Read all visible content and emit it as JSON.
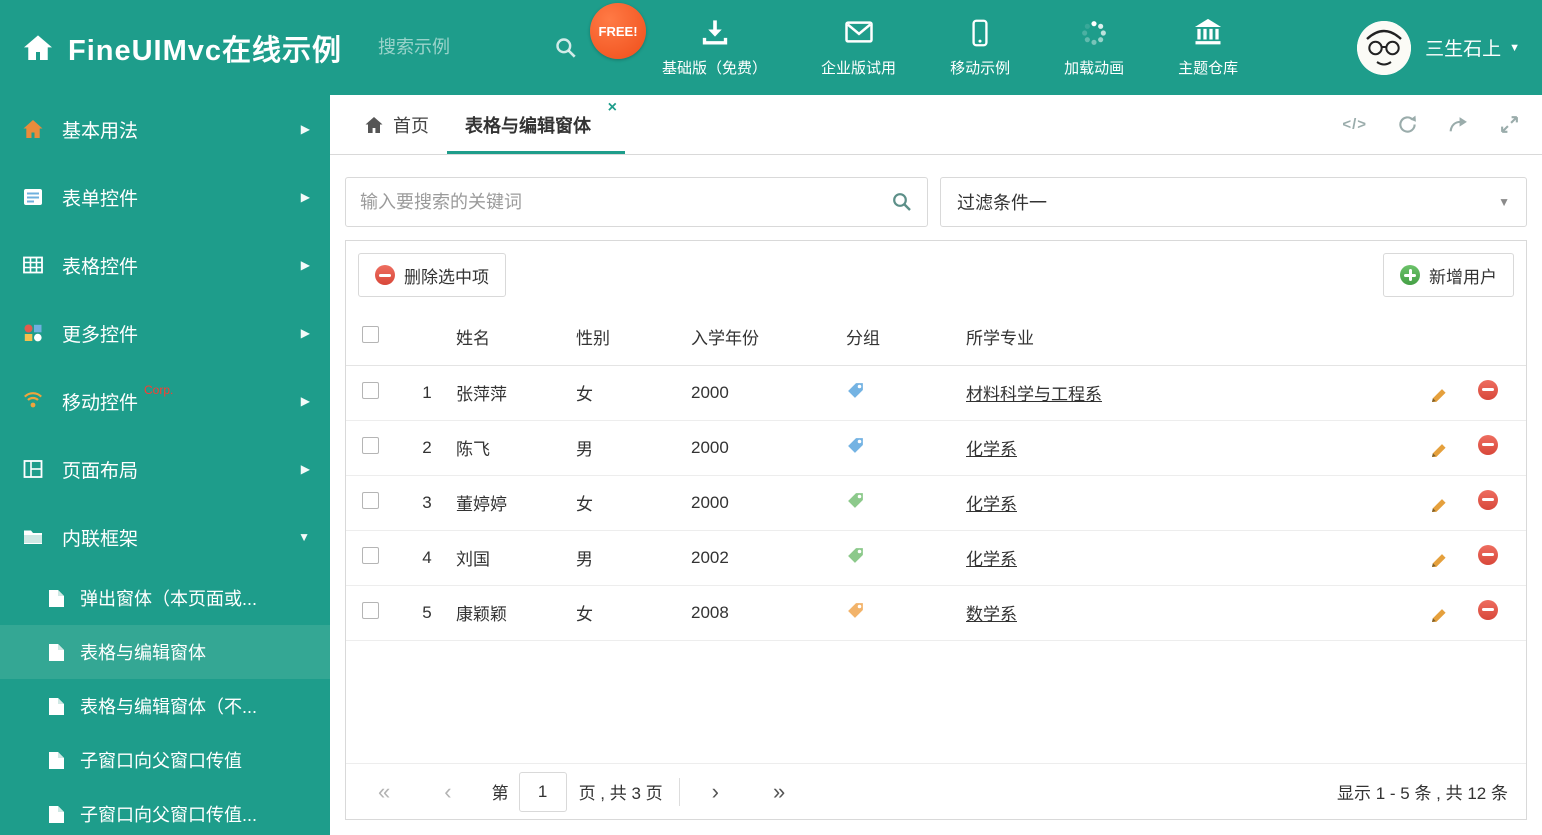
{
  "theme": {
    "accent": "#1e9d8b",
    "sidebar_selected": "#34a794",
    "free_badge_bg": "#ef4e1a",
    "delete_red": "#d8473a",
    "add_green": "#45a045",
    "edit_orange": "#e5a03c",
    "link_color": "#333333"
  },
  "icons": {
    "chevron_right": "▶",
    "chevron_down": "▼",
    "caret_down": "▼",
    "close": "×",
    "code": "</>",
    "page_first": "«",
    "page_prev": "‹",
    "page_next": "›",
    "page_last": "»"
  },
  "header": {
    "title": "FineUIMvc在线示例",
    "search_placeholder": "搜索示例",
    "free_badge": "FREE!",
    "nav_items": [
      {
        "label": "基础版（免费）",
        "icon": "download-icon"
      },
      {
        "label": "企业版试用",
        "icon": "envelope-icon"
      },
      {
        "label": "移动示例",
        "icon": "mobile-icon"
      },
      {
        "label": "加载动画",
        "icon": "spinner-icon"
      },
      {
        "label": "主题仓库",
        "icon": "bank-icon"
      }
    ],
    "user": {
      "name": "三生石上"
    }
  },
  "sidebar": {
    "items": [
      {
        "label": "基本用法",
        "icon": "home-icon"
      },
      {
        "label": "表单控件",
        "icon": "form-icon"
      },
      {
        "label": "表格控件",
        "icon": "table-icon"
      },
      {
        "label": "更多控件",
        "icon": "widgets-icon"
      },
      {
        "label": "移动控件",
        "badge": "Corp.",
        "icon": "signal-icon"
      },
      {
        "label": "页面布局",
        "icon": "layout-icon"
      },
      {
        "label": "内联框架",
        "icon": "frame-icon",
        "expanded": true
      }
    ],
    "subitems": [
      {
        "label": "弹出窗体（本页面或..."
      },
      {
        "label": "表格与编辑窗体",
        "selected": true
      },
      {
        "label": "表格与编辑窗体（不..."
      },
      {
        "label": "子窗口向父窗口传值"
      },
      {
        "label": "子窗口向父窗口传值..."
      }
    ]
  },
  "tabs": [
    {
      "label": "首页",
      "icon": "home-icon"
    },
    {
      "label": "表格与编辑窗体",
      "active": true,
      "closable": true
    }
  ],
  "filter": {
    "search_placeholder": "输入要搜索的关键词",
    "dropdown_value": "过滤条件一"
  },
  "toolbar": {
    "delete_label": "删除选中项",
    "add_label": "新增用户"
  },
  "table": {
    "columns": [
      "姓名",
      "性别",
      "入学年份",
      "分组",
      "所学专业"
    ],
    "rows": [
      {
        "num": "1",
        "name": "张萍萍",
        "gender": "女",
        "year": "2000",
        "tag_color": "#74b3e3",
        "major": "材料科学与工程系"
      },
      {
        "num": "2",
        "name": "陈飞",
        "gender": "男",
        "year": "2000",
        "tag_color": "#74b3e3",
        "major": "化学系"
      },
      {
        "num": "3",
        "name": "董婷婷",
        "gender": "女",
        "year": "2000",
        "tag_color": "#8cc98b",
        "major": "化学系"
      },
      {
        "num": "4",
        "name": "刘国",
        "gender": "男",
        "year": "2002",
        "tag_color": "#8cc98b",
        "major": "化学系"
      },
      {
        "num": "5",
        "name": "康颖颖",
        "gender": "女",
        "year": "2008",
        "tag_color": "#f2b36a",
        "major": "数学系"
      }
    ]
  },
  "pagination": {
    "prefix": "第",
    "current_page": "1",
    "suffix": "页 , 共 3 页",
    "summary": "显示 1 - 5 条 , 共 12 条"
  }
}
